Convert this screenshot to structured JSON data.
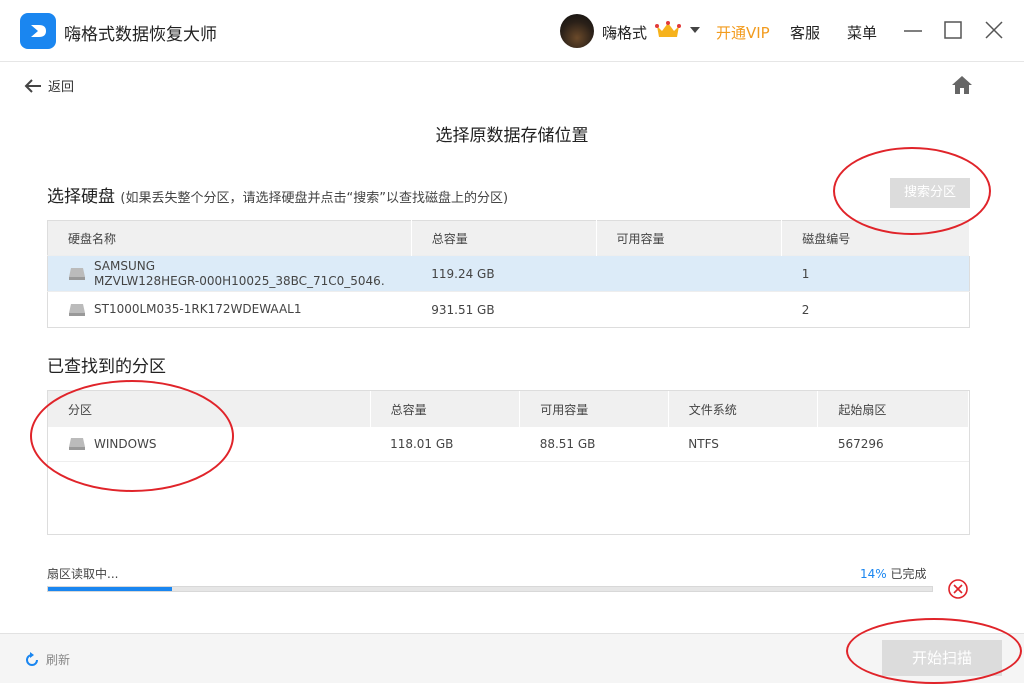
{
  "app": {
    "title": "嗨格式数据恢复大师"
  },
  "account": {
    "username": "嗨格式",
    "vip_label": "开通VIP",
    "service_label": "客服",
    "menu_label": "菜单"
  },
  "nav": {
    "back_label": "返回"
  },
  "page": {
    "title": "选择原数据存储位置"
  },
  "disk_section": {
    "title": "选择硬盘",
    "hint": "(如果丢失整个分区，请选择硬盘并点击“搜索”以查找磁盘上的分区)",
    "search_button": "搜索分区",
    "columns": [
      "硬盘名称",
      "总容量",
      "可用容量",
      "磁盘编号"
    ],
    "rows": [
      {
        "name_line1": "SAMSUNG",
        "name_line2": "MZVLW128HEGR-000H10025_38BC_71C0_5046.",
        "total": "119.24 GB",
        "free": "",
        "id": "1",
        "selected": true
      },
      {
        "name_line1": "ST1000LM035-1RK172WDEWAAL1",
        "name_line2": "",
        "total": "931.51 GB",
        "free": "",
        "id": "2",
        "selected": false
      }
    ]
  },
  "partition_section": {
    "title": "已查找到的分区",
    "columns": [
      "分区",
      "总容量",
      "可用容量",
      "文件系统",
      "起始扇区"
    ],
    "rows": [
      {
        "name": "WINDOWS",
        "total": "118.01 GB",
        "free": "88.51 GB",
        "fs": "NTFS",
        "start": "567296"
      }
    ]
  },
  "progress": {
    "label": "扇区读取中...",
    "percent": 14,
    "percent_text": "14%",
    "done_label": "已完成"
  },
  "footer": {
    "refresh_label": "刷新",
    "start_button": "开始扫描"
  },
  "colors": {
    "accent": "#1a86f0",
    "vip": "#f29b1e",
    "annotation": "#e0242a"
  }
}
